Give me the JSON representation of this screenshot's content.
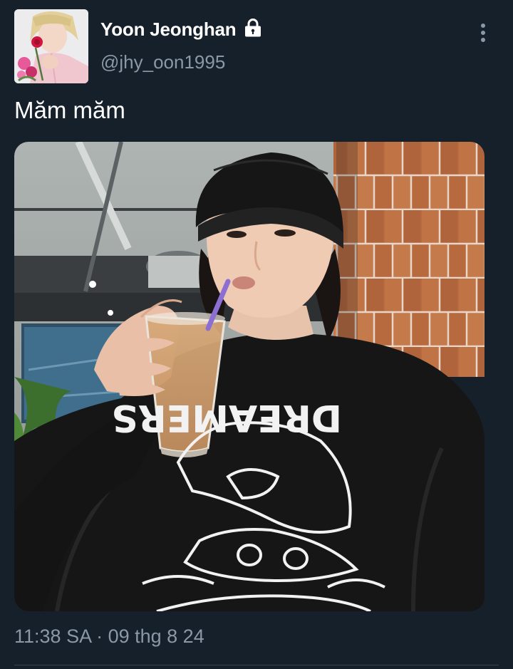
{
  "user": {
    "display_name": "Yoon Jeonghan",
    "handle": "@jhy_oon1995",
    "avatar": "profile-photo"
  },
  "tweet": {
    "text": "Măm măm",
    "timestamp": "11:38 SA · 09 thg 8 24"
  },
  "media": {
    "type": "photo",
    "shirt_text": "DREAMERS"
  },
  "icons": {
    "protected": "lock-icon",
    "more": "more-vertical-icon"
  },
  "colors": {
    "background": "#15202b",
    "text_primary": "#ffffff",
    "text_secondary": "#8b98a5",
    "divider": "#38444d"
  }
}
